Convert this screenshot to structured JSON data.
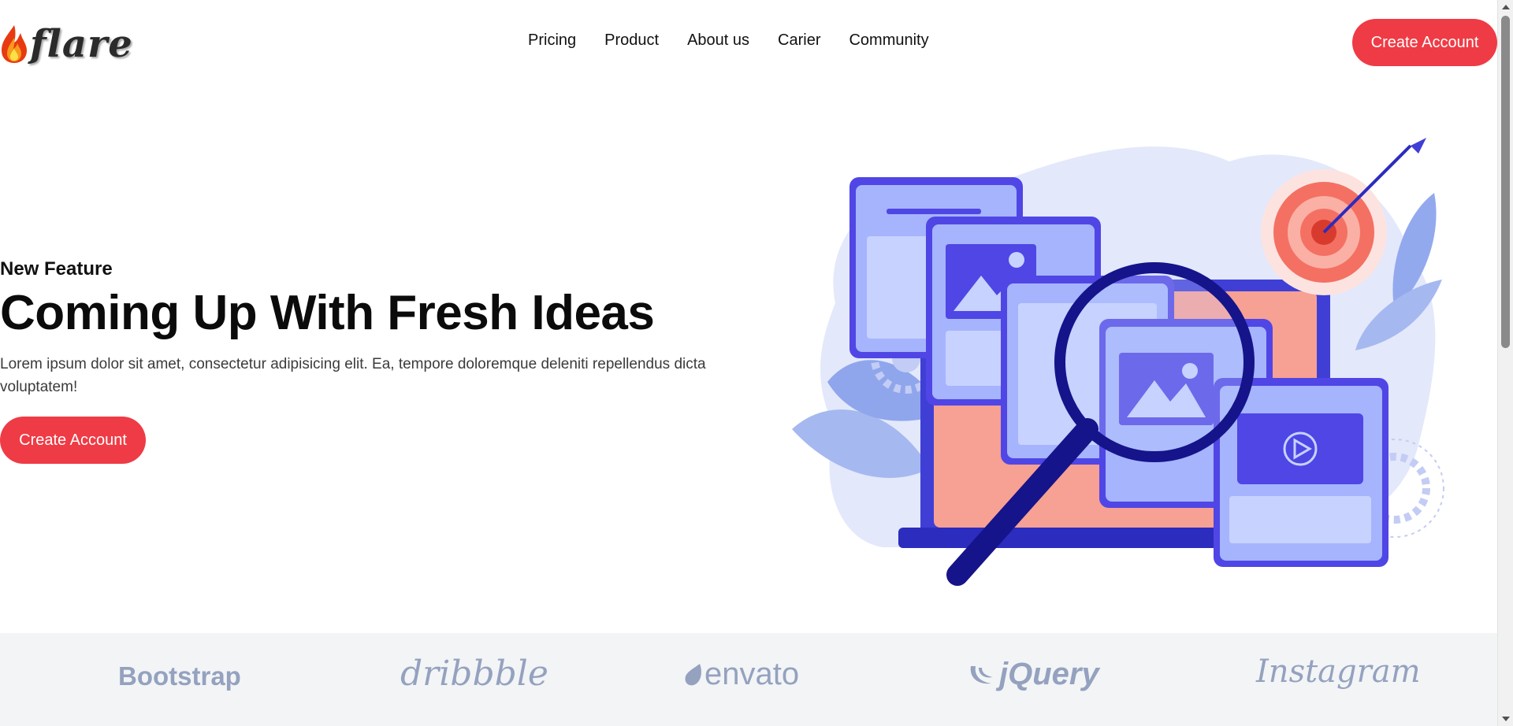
{
  "header": {
    "logo_text": "flare",
    "nav": [
      "Pricing",
      "Product",
      "About us",
      "Carier",
      "Community"
    ],
    "cta_label": "Create Account"
  },
  "hero": {
    "eyebrow": "New Feature",
    "title": "Coming Up With Fresh Ideas",
    "description": "Lorem ipsum dolor sit amet, consectetur adipisicing elit. Ea, tempore doloremque deleniti repellendus dicta voluptatem!",
    "cta_label": "Create Account",
    "illustration": "magnifier-browser-windows-target-illustration"
  },
  "brands": [
    "Bootstrap",
    "dribbble",
    "envato",
    "jQuery",
    "Instagram"
  ],
  "colors": {
    "accent": "#ef3b45",
    "brand_gray": "#94a2bf",
    "band_bg": "#f3f4f6",
    "illustration_primary": "#4f46e5",
    "illustration_light": "#c7d2fe"
  }
}
